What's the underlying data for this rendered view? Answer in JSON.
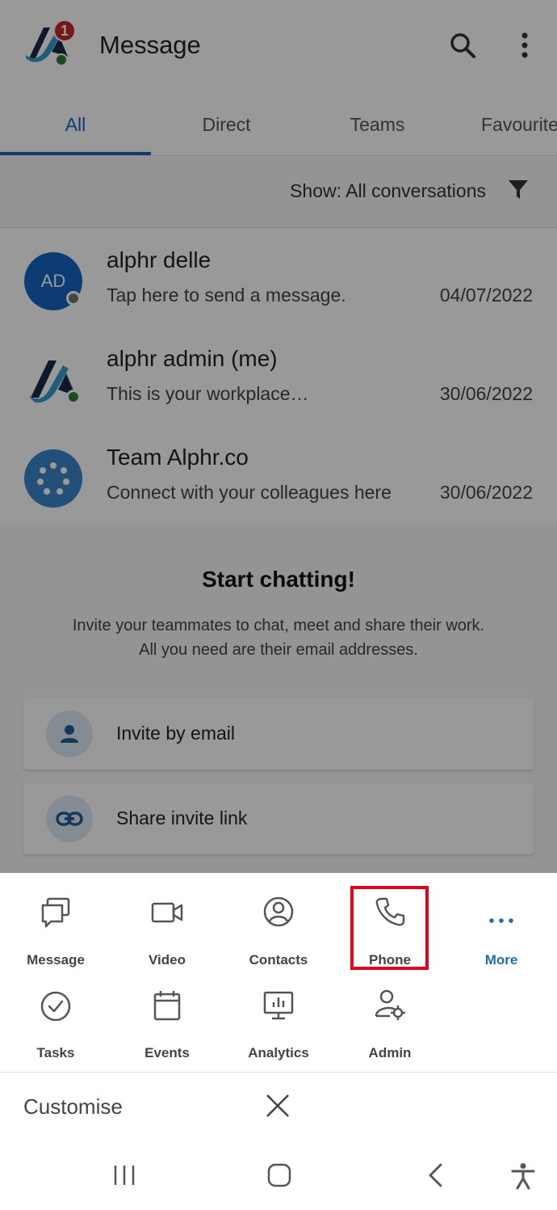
{
  "header": {
    "title": "Message",
    "badge_count": "1"
  },
  "tabs": [
    {
      "label": "All",
      "active": true
    },
    {
      "label": "Direct",
      "active": false
    },
    {
      "label": "Teams",
      "active": false
    },
    {
      "label": "Favourite",
      "active": false
    }
  ],
  "filter": {
    "prefix": "Show:",
    "value": "All conversations"
  },
  "conversations": [
    {
      "initials": "AD",
      "name": "alphr delle",
      "preview": "Tap here to send a message.",
      "date": "04/07/2022"
    },
    {
      "name": "alphr admin (me)",
      "preview": "This is your workplace…",
      "date": "30/06/2022"
    },
    {
      "name": "Team Alphr.co",
      "preview": "Connect with your colleagues here",
      "date": "30/06/2022"
    }
  ],
  "cta": {
    "title": "Start chatting!",
    "line1": "Invite your teammates to chat, meet and share their work.",
    "line2": "All you need are their email addresses."
  },
  "actions": {
    "invite_email": "Invite by email",
    "share_link": "Share invite link"
  },
  "menu": {
    "row1": [
      "Message",
      "Video",
      "Contacts",
      "Phone",
      "More"
    ],
    "row2": [
      "Tasks",
      "Events",
      "Analytics",
      "Admin"
    ]
  },
  "customise_label": "Customise",
  "colors": {
    "accent": "#1565c0",
    "highlight": "#e2001a",
    "badge": "#c62828"
  }
}
